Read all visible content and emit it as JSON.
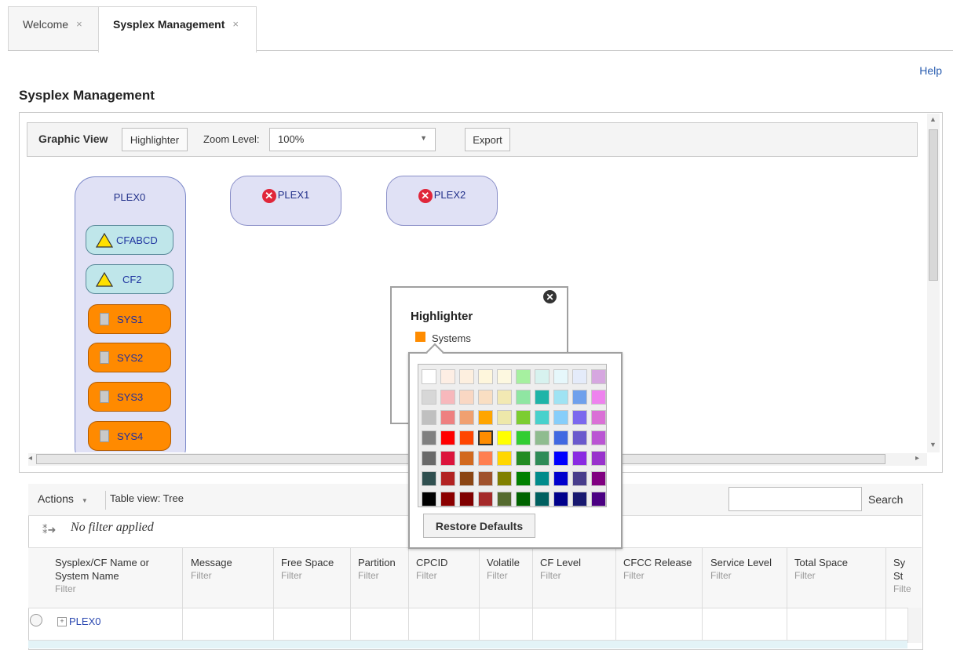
{
  "tabs": [
    {
      "label": "Welcome",
      "close": "×"
    },
    {
      "label": "Sysplex Management",
      "close": "×"
    }
  ],
  "help": "Help",
  "page_title": "Sysplex Management",
  "toolbar": {
    "graphic_view": "Graphic View",
    "highlighter": "Highlighter",
    "zoom_label": "Zoom Level:",
    "zoom_value": "100%",
    "export": "Export"
  },
  "graph": {
    "plex0": "PLEX0",
    "plex1": "PLEX1",
    "plex2": "PLEX2",
    "cf_nodes": [
      "CFABCD",
      "CF2"
    ],
    "sys_nodes": [
      "SYS1",
      "SYS2",
      "SYS3",
      "SYS4"
    ]
  },
  "highlighter": {
    "title": "Highlighter",
    "item": "Systems",
    "item_color": "#ff8c00",
    "restore": "Restore Defaults",
    "palette": [
      [
        "#ffffff",
        "#fdeee4",
        "#fdefdf",
        "#fef6dc",
        "#fdf8e0",
        "#a6f0a0",
        "#d7f2ef",
        "#e6f7fb",
        "#e4ebfa",
        "#d6a7e0"
      ],
      [
        "#d7d7d7",
        "#f7b8bc",
        "#f9d7c3",
        "#f9dec2",
        "#f2e9b3",
        "#8fe6a2",
        "#1fb4a8",
        "#9fe3f3",
        "#6fa0ec",
        "#ee82ee"
      ],
      [
        "#c0c0c0",
        "#ee8080",
        "#f0a070",
        "#ffa500",
        "#eee8aa",
        "#7ccd31",
        "#48d1cc",
        "#87cefa",
        "#7b68ee",
        "#da70d6"
      ],
      [
        "#808080",
        "#ff0000",
        "#ff4500",
        "#ff8c00",
        "#ffff00",
        "#32cd32",
        "#8fbc8f",
        "#4169e1",
        "#6a5acd",
        "#ba55d3"
      ],
      [
        "#696969",
        "#dc143c",
        "#d2691e",
        "#ff7f50",
        "#ffd700",
        "#228b22",
        "#2e8b57",
        "#0000ff",
        "#8a2be2",
        "#9932cc"
      ],
      [
        "#2f4f4f",
        "#b22222",
        "#8b4513",
        "#a0522d",
        "#808000",
        "#008000",
        "#008b8b",
        "#0000cd",
        "#483d8b",
        "#800080"
      ],
      [
        "#000000",
        "#8b0000",
        "#800000",
        "#a52a2a",
        "#556b2f",
        "#006400",
        "#006060",
        "#00008b",
        "#191970",
        "#4b0082"
      ]
    ],
    "selected": [
      3,
      3
    ]
  },
  "table": {
    "actions": "Actions",
    "view": "Table view: Tree",
    "search": "Search",
    "no_filter": "No filter applied",
    "filter_text": "Filter",
    "columns": [
      {
        "l1": "Sysplex/CF Name or",
        "l2": "System Name"
      },
      {
        "l1": "Message"
      },
      {
        "l1": "Free Space"
      },
      {
        "l1": "Partition"
      },
      {
        "l1": "CPCID"
      },
      {
        "l1": "Volatile"
      },
      {
        "l1": "CF Level"
      },
      {
        "l1": "CFCC Release"
      },
      {
        "l1": "Service Level"
      },
      {
        "l1": "Total Space"
      },
      {
        "l1": "Sy",
        "l2": "St"
      }
    ],
    "rows": [
      {
        "name": "PLEX0"
      }
    ]
  }
}
